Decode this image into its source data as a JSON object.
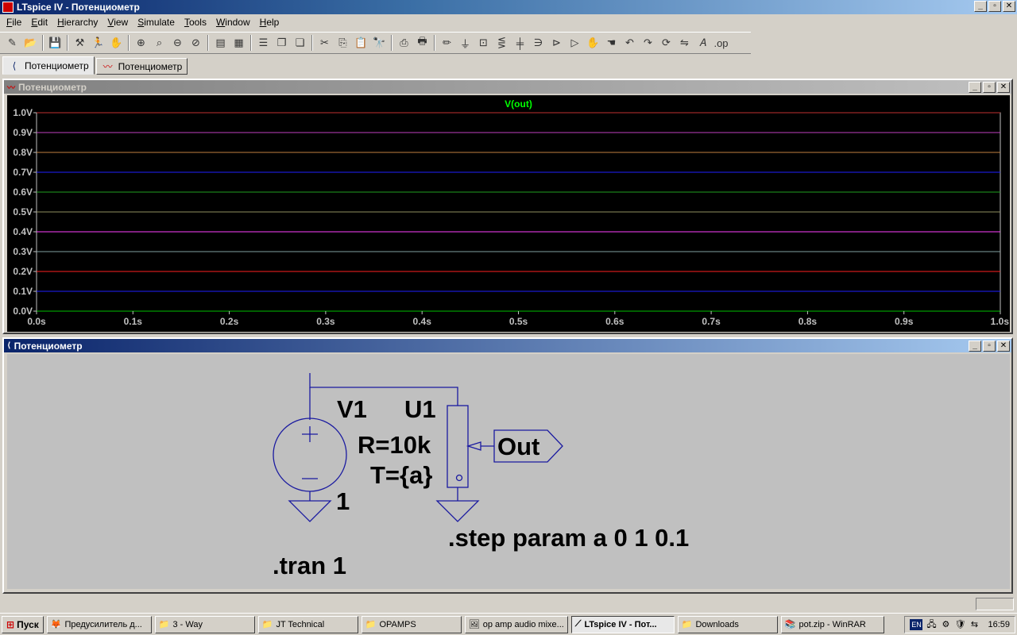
{
  "window": {
    "title": "LTspice IV - Потенциометр",
    "min": "_",
    "max": "▫",
    "close": "✕"
  },
  "menu": [
    {
      "label": "File",
      "u": "F",
      "rest": "ile"
    },
    {
      "label": "Edit",
      "u": "E",
      "rest": "dit"
    },
    {
      "label": "Hierarchy",
      "u": "H",
      "rest": "ierarchy"
    },
    {
      "label": "View",
      "u": "V",
      "rest": "iew"
    },
    {
      "label": "Simulate",
      "u": "S",
      "rest": "imulate"
    },
    {
      "label": "Tools",
      "u": "T",
      "rest": "ools"
    },
    {
      "label": "Window",
      "u": "W",
      "rest": "indow"
    },
    {
      "label": "Help",
      "u": "H",
      "rest": "elp"
    }
  ],
  "tabs": [
    {
      "label": "Потенциометр",
      "icon": "schematic-icon"
    },
    {
      "label": "Потенциометр",
      "icon": "waveform-icon"
    }
  ],
  "plot_window": {
    "title": "Потенциометр"
  },
  "schematic_window": {
    "title": "Потенциометр"
  },
  "chart_data": {
    "type": "line",
    "title": "V(out)",
    "xlim": [
      0,
      1
    ],
    "ylim": [
      0,
      1
    ],
    "x_ticks": [
      "0.0s",
      "0.1s",
      "0.2s",
      "0.3s",
      "0.4s",
      "0.5s",
      "0.6s",
      "0.7s",
      "0.8s",
      "0.9s",
      "1.0s"
    ],
    "y_ticks": [
      "0.0V",
      "0.1V",
      "0.2V",
      "0.3V",
      "0.4V",
      "0.5V",
      "0.6V",
      "0.7V",
      "0.8V",
      "0.9V",
      "1.0V"
    ],
    "series": [
      {
        "x": [
          0,
          1
        ],
        "values": [
          0.0,
          0.0
        ],
        "color": "#00c000"
      },
      {
        "x": [
          0,
          1
        ],
        "values": [
          0.1,
          0.1
        ],
        "color": "#2020ff"
      },
      {
        "x": [
          0,
          1
        ],
        "values": [
          0.2,
          0.2
        ],
        "color": "#ff2020"
      },
      {
        "x": [
          0,
          1
        ],
        "values": [
          0.3,
          0.3
        ],
        "color": "#80a0a0"
      },
      {
        "x": [
          0,
          1
        ],
        "values": [
          0.4,
          0.4
        ],
        "color": "#ff40ff"
      },
      {
        "x": [
          0,
          1
        ],
        "values": [
          0.5,
          0.5
        ],
        "color": "#909060"
      },
      {
        "x": [
          0,
          1
        ],
        "values": [
          0.6,
          0.6
        ],
        "color": "#20a020"
      },
      {
        "x": [
          0,
          1
        ],
        "values": [
          0.7,
          0.7
        ],
        "color": "#2020ff"
      },
      {
        "x": [
          0,
          1
        ],
        "values": [
          0.8,
          0.8
        ],
        "color": "#c08040"
      },
      {
        "x": [
          0,
          1
        ],
        "values": [
          0.9,
          0.9
        ],
        "color": "#c040c0"
      },
      {
        "x": [
          0,
          1
        ],
        "values": [
          1.0,
          1.0
        ],
        "color": "#c03030"
      }
    ],
    "grid": false,
    "title_color": "#00ff00",
    "axis_color": "#c0c0c0"
  },
  "schematic": {
    "v1_name": "V1",
    "v1_value": "1",
    "u1_name": "U1",
    "u1_r": "R=10k",
    "u1_t": "T={a}",
    "net_label": "Out",
    "directive_step": ".step param a 0 1 0.1",
    "directive_tran": ".tran 1",
    "wire_color": "#1a1aa0"
  },
  "taskbar": {
    "start": "Пуск",
    "items": [
      {
        "label": "Предусилитель д...",
        "icon": "firefox-icon"
      },
      {
        "label": "3 - Way",
        "icon": "folder-icon"
      },
      {
        "label": "JT Technical",
        "icon": "folder-icon"
      },
      {
        "label": "OPAMPS",
        "icon": "folder-icon"
      },
      {
        "label": "op amp audio mixe...",
        "icon": "image-icon"
      },
      {
        "label": "LTspice IV - Пот...",
        "icon": "ltspice-icon",
        "active": true
      },
      {
        "label": "Downloads",
        "icon": "folder-icon"
      },
      {
        "label": "pot.zip - WinRAR",
        "icon": "winrar-icon"
      }
    ],
    "lang": "EN",
    "clock": "16:59"
  }
}
